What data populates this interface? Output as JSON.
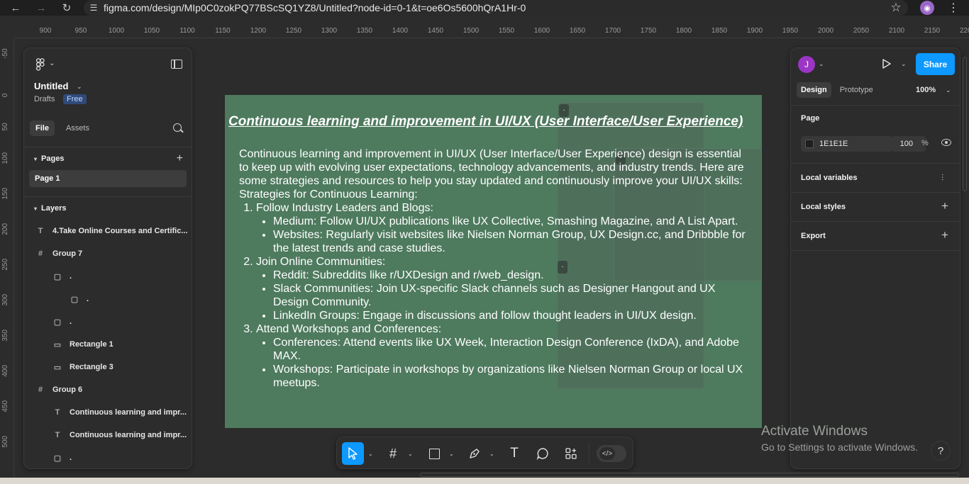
{
  "browser": {
    "url": "figma.com/design/MIp0C0zokPQ77BScSQ1YZ8/Untitled?node-id=0-1&t=oe6Os5600hQrA1Hr-0"
  },
  "rulers": {
    "top": [
      "900",
      "950",
      "1000",
      "1050",
      "1100",
      "1150",
      "1200",
      "1250",
      "1300",
      "1350",
      "1400",
      "1450",
      "1500",
      "1550",
      "1600",
      "1650",
      "1700",
      "1750",
      "1800",
      "1850",
      "1900",
      "1950",
      "2000",
      "2050",
      "2100",
      "2150",
      "2200"
    ],
    "left": [
      "-50",
      "0",
      "50",
      "100",
      "150",
      "200",
      "250",
      "300",
      "350",
      "400",
      "450",
      "500"
    ]
  },
  "left_panel": {
    "file_title": "Untitled",
    "drafts": "Drafts",
    "plan_badge": "Free",
    "tabs": [
      "File",
      "Assets"
    ],
    "pages_header": "Pages",
    "pages": [
      "Page 1"
    ],
    "layers_header": "Layers",
    "layers": [
      {
        "icon": "T",
        "label": "4.Take Online Courses and Certific...",
        "indent": 0,
        "bold": true
      },
      {
        "icon": "#",
        "label": "Group 7",
        "indent": 0,
        "bold": true
      },
      {
        "icon": "▢",
        "label": ".",
        "indent": 1,
        "bold": true
      },
      {
        "icon": "▢",
        "label": ".",
        "indent": 2,
        "bold": true
      },
      {
        "icon": "▢",
        "label": ".",
        "indent": 1,
        "bold": true
      },
      {
        "icon": "▭",
        "label": "Rectangle 1",
        "indent": 1,
        "bold": true
      },
      {
        "icon": "▭",
        "label": "Rectangle 3",
        "indent": 1,
        "bold": true
      },
      {
        "icon": "#",
        "label": "Group 6",
        "indent": 0,
        "bold": true
      },
      {
        "icon": "T",
        "label": "Continuous learning and impr...",
        "indent": 1,
        "bold": true
      },
      {
        "icon": "T",
        "label": "Continuous learning and impr...",
        "indent": 1,
        "bold": true
      },
      {
        "icon": "▢",
        "label": ".",
        "indent": 1,
        "bold": true
      }
    ]
  },
  "frame": {
    "title": "Continuous learning and improvement in UI/UX (User Interface/User Experience)",
    "intro": "Continuous learning and improvement in UI/UX (User Interface/User Experience) design is essential to keep up with evolving user expectations, technology advancements, and industry trends. Here are some strategies and resources to help you stay updated and continuously improve your UI/UX skills:",
    "strategies_label": "Strategies for Continuous Learning:",
    "sections": [
      {
        "title": "Follow Industry Leaders and Blogs:",
        "items": [
          "Medium: Follow UI/UX publications like UX Collective, Smashing Magazine, and A List Apart.",
          "Websites: Regularly visit websites like Nielsen Norman Group, UX Design.cc, and Dribbble for the latest trends and case studies."
        ]
      },
      {
        "title": "Join Online Communities:",
        "items": [
          "Reddit: Subreddits like r/UXDesign and r/web_design.",
          "Slack Communities: Join UX-specific Slack channels such as Designer Hangout and UX Design Community.",
          "LinkedIn Groups: Engage in discussions and follow thought leaders in UI/UX design."
        ]
      },
      {
        "title": "Attend Workshops and Conferences:",
        "items": [
          "Conferences: Attend events like UX Week, Interaction Design Conference (IxDA), and Adobe MAX.",
          "Workshops: Participate in workshops by organizations like Nielsen Norman Group or local UX meetups."
        ]
      }
    ],
    "dot_labels": [
      ".",
      ".",
      "."
    ],
    "background": "#4e7a5e"
  },
  "right_panel": {
    "avatar_letter": "J",
    "share_label": "Share",
    "tabs": [
      "Design",
      "Prototype"
    ],
    "zoom": "100%",
    "page_label": "Page",
    "bg_color_hex": "1E1E1E",
    "bg_opacity": "100",
    "pct": "%",
    "local_variables": "Local variables",
    "local_styles": "Local styles",
    "export": "Export"
  },
  "watermark": {
    "line1": "Activate Windows",
    "line2": "Go to Settings to activate Windows."
  },
  "help": "?",
  "colors": {
    "accent": "#0d99ff",
    "frame_bg": "#4e7a5e",
    "panel_bg": "#2c2c2c"
  }
}
